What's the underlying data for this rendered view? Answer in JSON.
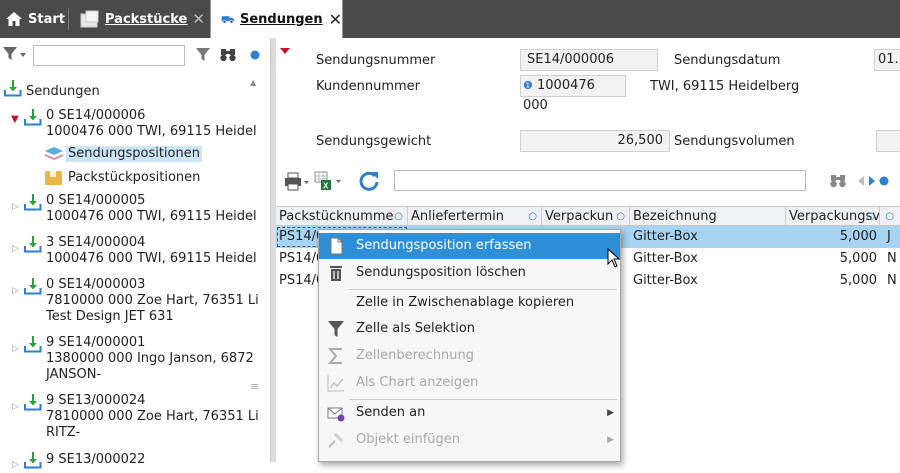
{
  "tabs": {
    "start": "Start",
    "packstuecke": "Packstücke",
    "sendungen": "Sendungen",
    "close_glyph": "✕"
  },
  "left_panel": {
    "filter_placeholder": "",
    "tree": {
      "root": "Sendungen",
      "nodes": [
        {
          "line1": "0 SE14/000006",
          "line2": "1000476 000 TWI, 69115 Heidel",
          "expanded": true
        },
        {
          "line1": "0 SE14/000005",
          "line2": "1000476 000 TWI, 69115 Heidel"
        },
        {
          "line1": "3 SE14/000004",
          "line2": "1000476 000 TWI, 69115 Heidel"
        },
        {
          "line1": "0 SE14/000003",
          "line2": "7810000 000 Zoe Hart, 76351 Li",
          "line3": "Test Design JET 631"
        },
        {
          "line1": "9 SE14/000001",
          "line2": "1380000 000 Ingo Janson, 6872",
          "line3": "JANSON-"
        },
        {
          "line1": "9 SE13/000024",
          "line2": "7810000 000 Zoe Hart, 76351 Li",
          "line3": "RITZ-"
        },
        {
          "line1": "9 SE13/000022"
        }
      ],
      "children": {
        "sendungspositionen": "Sendungspositionen",
        "packstueckpositionen": "Packstückpositionen"
      }
    }
  },
  "form": {
    "sendungsnummer_label": "Sendungsnummer",
    "sendungsnummer_value": "SE14/000006",
    "sendungsdatum_label": "Sendungsdatum",
    "sendungsdatum_value": "01.",
    "kundennummer_label": "Kundennummer",
    "kundennummer_info": "❶",
    "kundennummer_value": "1000476 000",
    "kunde_text": "TWI, 69115 Heidelberg",
    "sendungsgewicht_label": "Sendungsgewicht",
    "sendungsgewicht_value": "26,500",
    "sendungsvolumen_label": "Sendungsvolumen",
    "sendungsvolumen_value": ""
  },
  "grid": {
    "search_placeholder": "",
    "columns": [
      "Packstücknumme",
      "Anliefertermin",
      "Verpackun",
      "Bezeichnung",
      "Verpackungsv",
      ""
    ],
    "rows": [
      {
        "packstueck": "PS14/0",
        "bezeichnung": "Gitter-Box",
        "verpackungsv": "5,000",
        "flag": "J"
      },
      {
        "packstueck": "PS14/0",
        "bezeichnung": "Gitter-Box",
        "verpackungsv": "5,000",
        "flag": "N"
      },
      {
        "packstueck": "PS14/0",
        "bezeichnung": "Gitter-Box",
        "verpackungsv": "5,000",
        "flag": "N"
      }
    ]
  },
  "context_menu": {
    "items": [
      {
        "label": "Sendungsposition erfassen",
        "icon": "new-document-icon",
        "state": "selected"
      },
      {
        "label": "Sendungsposition löschen",
        "icon": "trash-icon",
        "state": "enabled"
      },
      {
        "label": "Zelle in Zwischenablage kopieren",
        "icon": "",
        "state": "enabled"
      },
      {
        "label": "Zelle als Selektion",
        "icon": "filter-icon",
        "state": "enabled"
      },
      {
        "label": "Zellenberechnung",
        "icon": "sigma-icon",
        "state": "disabled"
      },
      {
        "label": "Als Chart anzeigen",
        "icon": "chart-icon",
        "state": "disabled"
      },
      {
        "label": "Senden an",
        "icon": "send-envelope-icon",
        "state": "enabled",
        "submenu": true
      },
      {
        "label": "Objekt einfügen",
        "icon": "pin-icon",
        "state": "disabled",
        "submenu": true
      }
    ]
  },
  "colors": {
    "accent": "#2e8fd6",
    "selected_row": "#a6d4f2",
    "tree_highlight": "#cde6f6",
    "tab_bar": "#4a4a4a",
    "collapse_red": "#c8102e",
    "send_icon_green": "#2e9e3e"
  }
}
